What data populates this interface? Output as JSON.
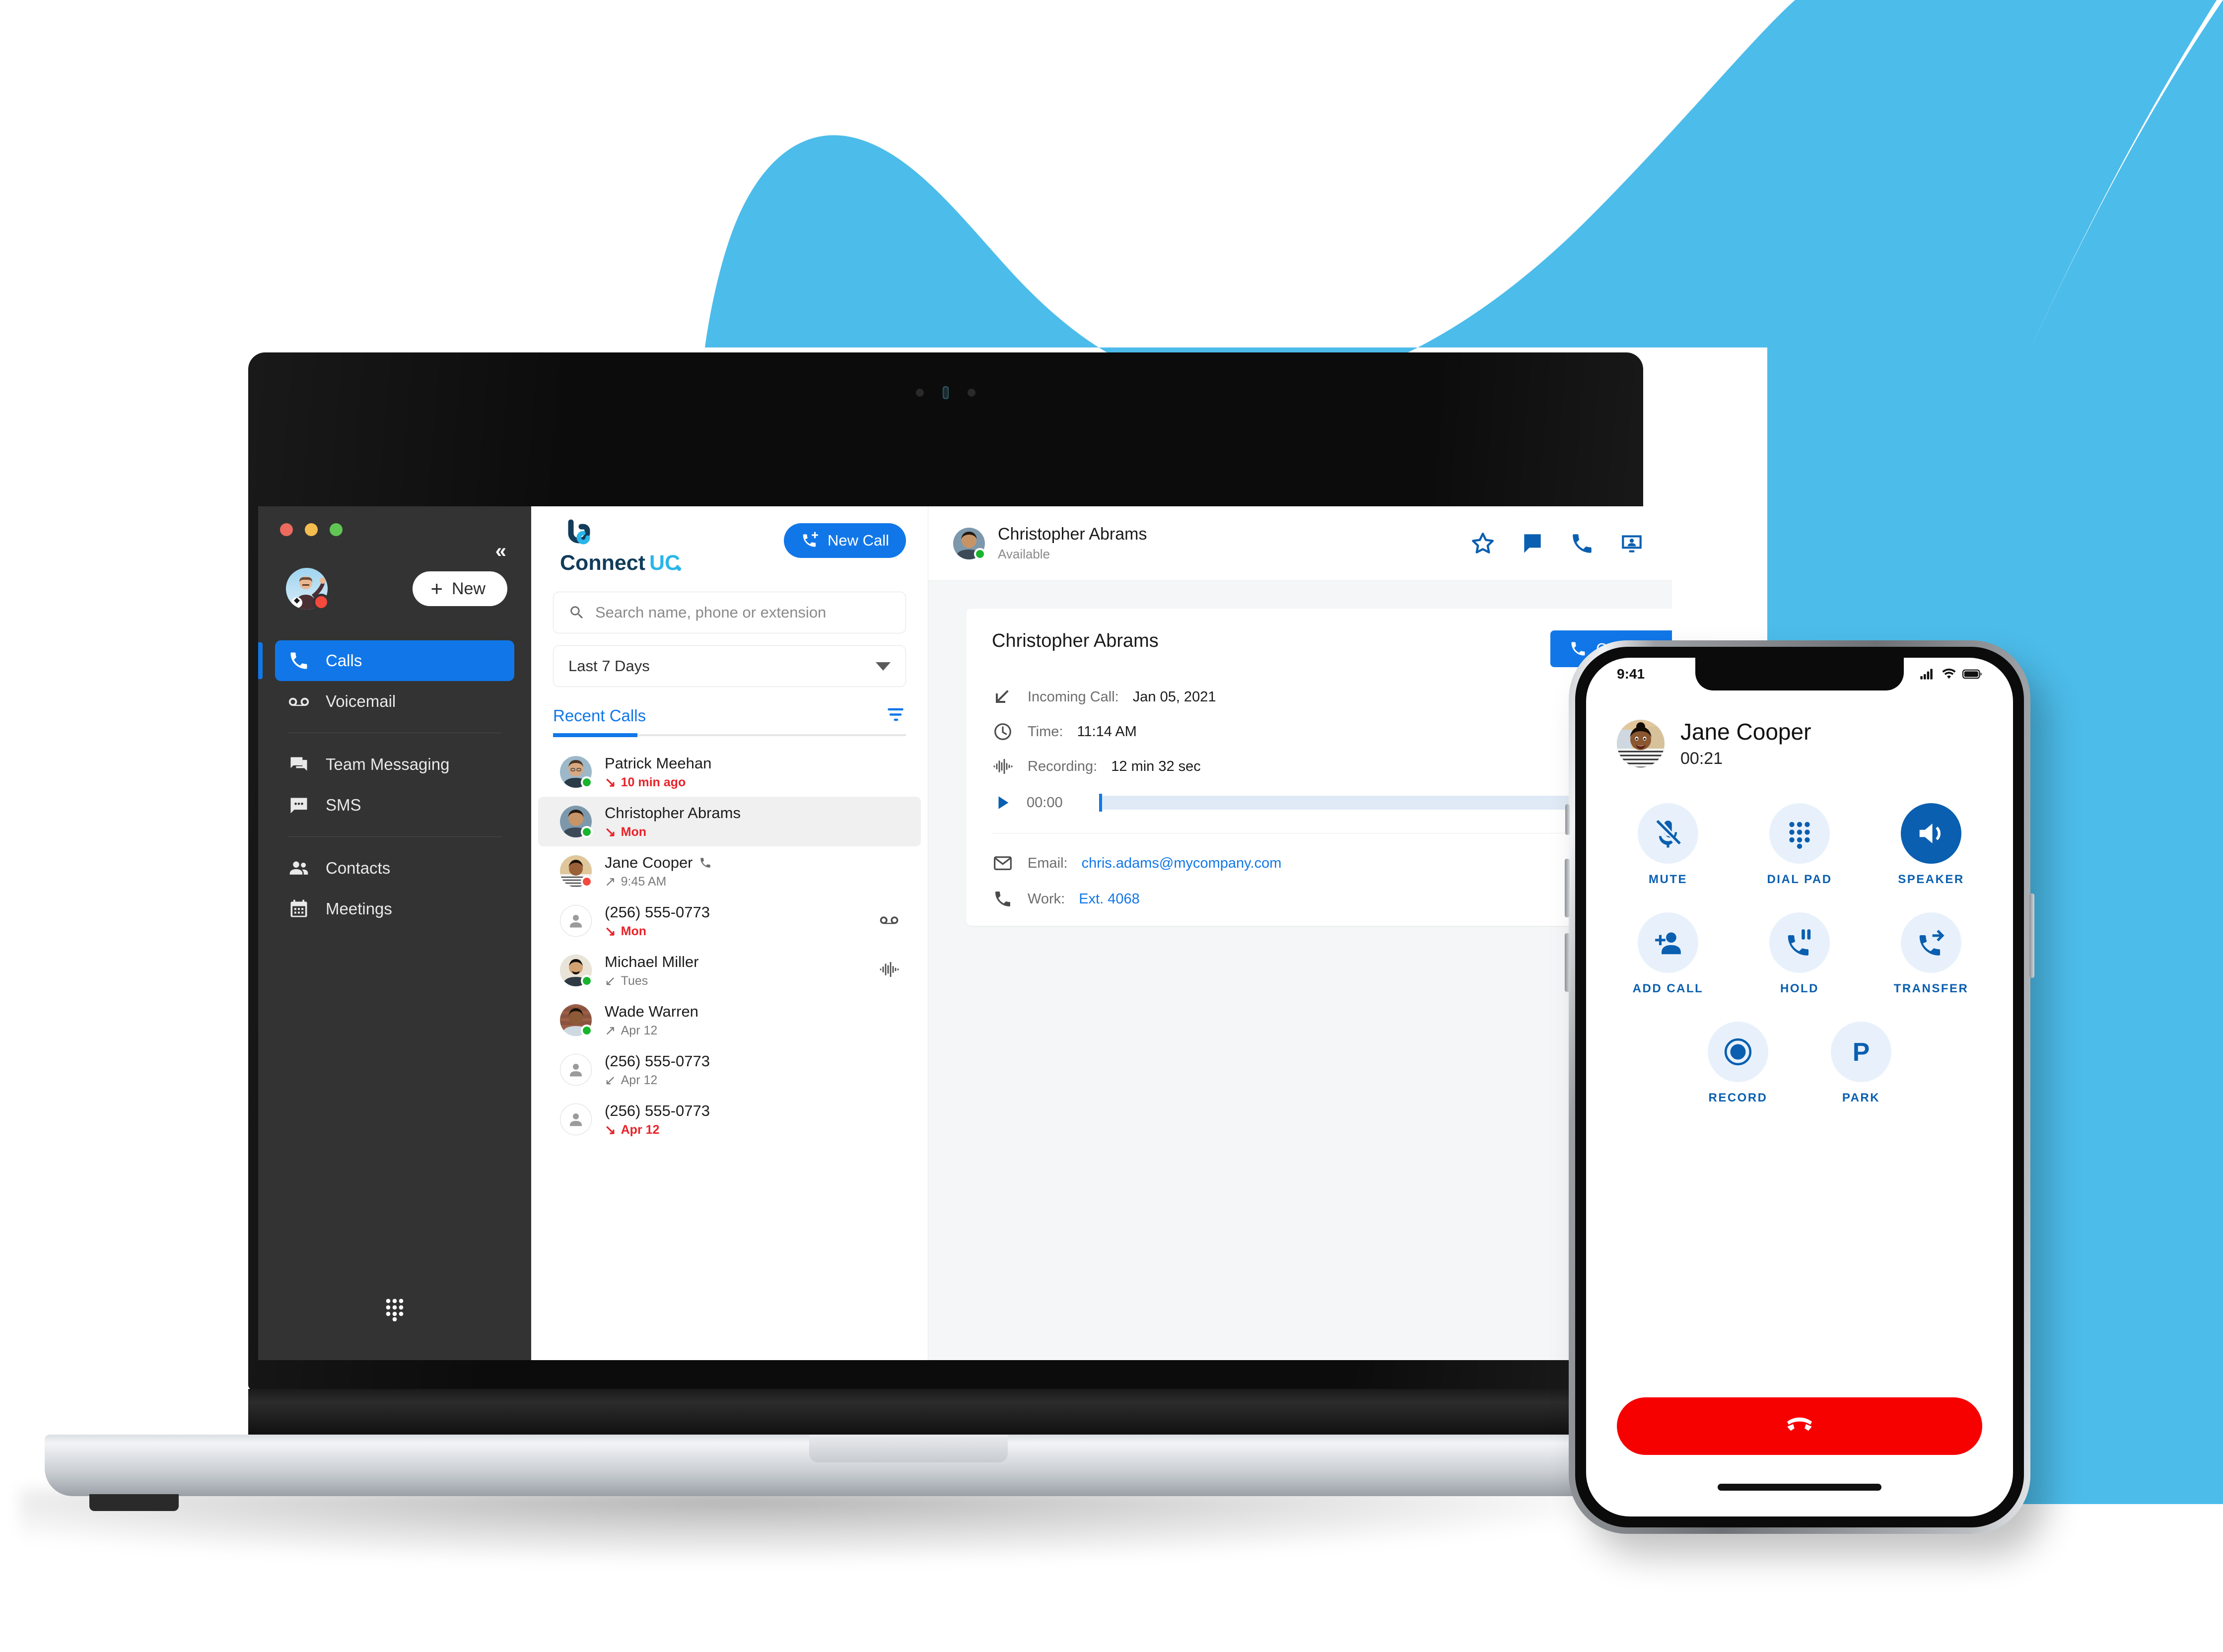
{
  "theme": {
    "brand_blue": "#1177e8",
    "deep_blue": "#0a5fb0",
    "wave_blue": "#4cbcea",
    "sidebar_bg": "#333333",
    "missed_red": "#e8232a",
    "endcall_red": "#f70000",
    "available_green": "#18b42e",
    "busy_red": "#f5493d"
  },
  "desktop": {
    "window_controls": [
      "close",
      "minimize",
      "zoom"
    ],
    "sidebar": {
      "collapse_label": "«",
      "new_button_label": "New",
      "user_presence": "busy",
      "items": [
        {
          "label": "Calls",
          "icon": "phone-icon",
          "active": true,
          "group": 0
        },
        {
          "label": "Voicemail",
          "icon": "voicemail-icon",
          "active": false,
          "group": 0
        },
        {
          "label": "Team Messaging",
          "icon": "chat-bubbles-icon",
          "active": false,
          "group": 1
        },
        {
          "label": "SMS",
          "icon": "sms-icon",
          "active": false,
          "group": 1
        },
        {
          "label": "Contacts",
          "icon": "people-icon",
          "active": false,
          "group": 2
        },
        {
          "label": "Meetings",
          "icon": "calendar-icon",
          "active": false,
          "group": 2
        }
      ],
      "dialpad_icon": "dialpad-icon"
    },
    "list_panel": {
      "logo_text_1": "Connect",
      "logo_text_2": "UC",
      "new_call_label": "New Call",
      "search_placeholder": "Search name, phone or extension",
      "search_value": "",
      "range_filter_value": "Last 7 Days",
      "tab_label": "Recent Calls",
      "filter_icon": "filter-icon",
      "calls": [
        {
          "name": "Patrick Meehan",
          "time": "10 min ago",
          "direction": "missed",
          "status": "missed",
          "presence": "available",
          "avatar": "photo",
          "right_icon": ""
        },
        {
          "name": "Christopher Abrams",
          "time": "Mon",
          "direction": "missed",
          "status": "missed",
          "presence": "available",
          "avatar": "photo",
          "right_icon": "",
          "selected": true
        },
        {
          "name": "Jane Cooper",
          "time": "9:45 AM",
          "direction": "outgoing",
          "status": "normal",
          "presence": "busy",
          "avatar": "photo",
          "right_icon": "",
          "name_icon": "phone-icon"
        },
        {
          "name": "(256) 555-0773",
          "time": "Mon",
          "direction": "missed",
          "status": "missed",
          "presence": "none",
          "avatar": "placeholder",
          "right_icon": "voicemail-icon"
        },
        {
          "name": "Michael Miller",
          "time": "Tues",
          "direction": "incoming",
          "status": "normal",
          "presence": "available",
          "avatar": "photo",
          "right_icon": "waveform-icon"
        },
        {
          "name": "Wade Warren",
          "time": "Apr 12",
          "direction": "outgoing",
          "status": "normal",
          "presence": "available",
          "avatar": "photo",
          "right_icon": ""
        },
        {
          "name": "(256) 555-0773",
          "time": "Apr 12",
          "direction": "incoming",
          "status": "normal",
          "presence": "none",
          "avatar": "placeholder",
          "right_icon": ""
        },
        {
          "name": "(256) 555-0773",
          "time": "Apr 12",
          "direction": "missed",
          "status": "missed",
          "presence": "none",
          "avatar": "placeholder",
          "right_icon": ""
        }
      ]
    },
    "detail": {
      "header_name": "Christopher Abrams",
      "header_status": "Available",
      "header_actions": [
        "star-icon",
        "chat-icon",
        "phone-icon",
        "video-contact-icon"
      ],
      "card": {
        "title": "Christopher Abrams",
        "callback_label": "Call Back",
        "rows": [
          {
            "icon": "incoming-call-icon",
            "label": "Incoming Call:",
            "value": "Jan 05, 2021"
          },
          {
            "icon": "clock-icon",
            "label": "Time:",
            "value": "11:14 AM"
          },
          {
            "icon": "waveform-icon",
            "label": "Recording:",
            "value": "12 min 32 sec"
          }
        ],
        "player": {
          "play_icon": "play-icon",
          "current_time": "00:00",
          "progress_percent": 0
        },
        "contact_rows": [
          {
            "icon": "mail-icon",
            "label": "Email:",
            "value": "chris.adams@mycompany.com",
            "link": true
          },
          {
            "icon": "phone-icon",
            "label": "Work:",
            "value": "Ext. 4068",
            "link": true
          }
        ]
      }
    }
  },
  "phone": {
    "status_bar": {
      "time": "9:41",
      "icons": [
        "cellular-icon",
        "wifi-icon",
        "battery-icon"
      ]
    },
    "caller": {
      "name": "Jane Cooper",
      "timer": "00:21"
    },
    "controls": [
      {
        "label": "MUTE",
        "icon": "mic-off-icon",
        "active": false
      },
      {
        "label": "DIAL PAD",
        "icon": "dialpad-icon",
        "active": false
      },
      {
        "label": "SPEAKER",
        "icon": "speaker-icon",
        "active": true
      },
      {
        "label": "ADD CALL",
        "icon": "person-add-icon",
        "active": false
      },
      {
        "label": "HOLD",
        "icon": "call-hold-icon",
        "active": false
      },
      {
        "label": "TRANSFER",
        "icon": "call-transfer-icon",
        "active": false
      },
      {
        "label": "RECORD",
        "icon": "record-icon",
        "active": false
      },
      {
        "label": "PARK",
        "icon": "park-p-icon",
        "active": false
      }
    ],
    "end_call_icon": "end-call-icon"
  }
}
